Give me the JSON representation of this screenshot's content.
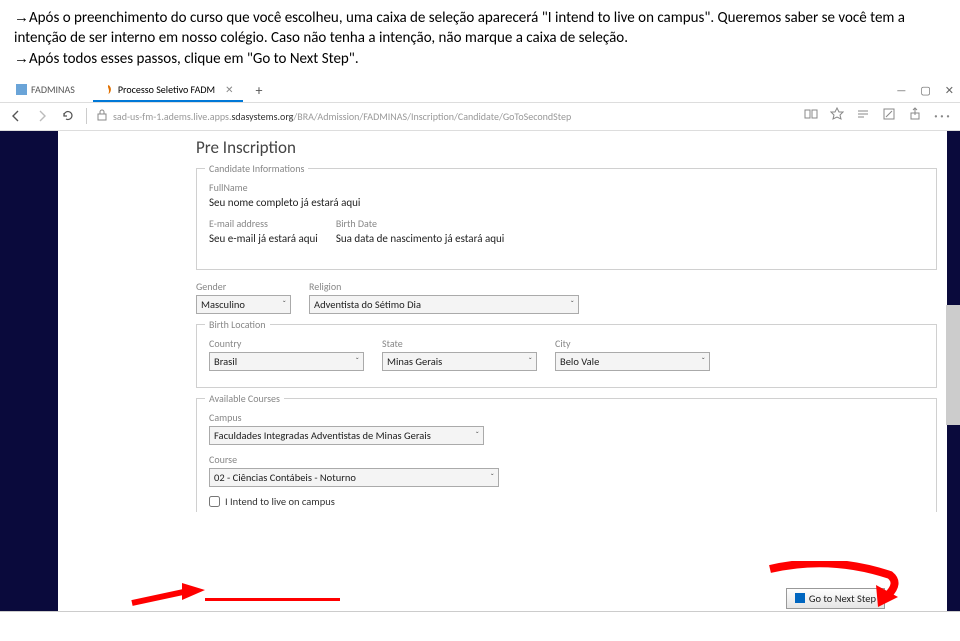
{
  "instructions": {
    "line1_prefix": "→",
    "line1": "Após o preenchimento do curso que você escolheu, uma caixa de seleção aparecerá \"I intend to live on campus\". Queremos saber se você tem a intenção de ser interno em nosso colégio. Caso não tenha a intenção, não marque a caixa de seleção.",
    "line2_prefix": "→",
    "line2": "Após todos esses passos, clique em \"Go to Next Step\"."
  },
  "tabs": {
    "tab1": "FADMINAS",
    "tab2": "Processo Seletivo FADM"
  },
  "window": {
    "min": "—",
    "max": "▢",
    "close": "✕"
  },
  "address": {
    "part1": "sad-us-fm-1.adems.live.apps.",
    "part2": "sdasystems.org",
    "part3": "/BRA/Admission/FADMINAS/Inscription/Candidate/GoToSecondStep"
  },
  "page": {
    "title": "Pre Inscription",
    "sections": {
      "candidate": {
        "legend": "Candidate Informations",
        "fullname_label": "FullName",
        "fullname_note": "Seu nome completo já estará aqui",
        "email_label": "E-mail address",
        "email_note": "Seu e-mail já estará aqui",
        "birth_label": "Birth Date",
        "birth_note": "Sua data de nascimento já estará aqui"
      },
      "genderrel": {
        "gender_label": "Gender",
        "gender_value": "Masculino",
        "religion_label": "Religion",
        "religion_value": "Adventista do Sétimo Dia"
      },
      "birthloc": {
        "legend": "Birth Location",
        "country_label": "Country",
        "country_value": "Brasil",
        "state_label": "State",
        "state_value": "Minas Gerais",
        "city_label": "City",
        "city_value": "Belo Vale"
      },
      "courses": {
        "legend": "Available Courses",
        "campus_label": "Campus",
        "campus_value": "Faculdades Integradas Adventistas de Minas Gerais",
        "course_label": "Course",
        "course_value": "02 - Ciências Contábeis - Noturno",
        "checkbox_label": "I Intend to live on campus"
      }
    },
    "next_button": "Go to Next Step"
  }
}
